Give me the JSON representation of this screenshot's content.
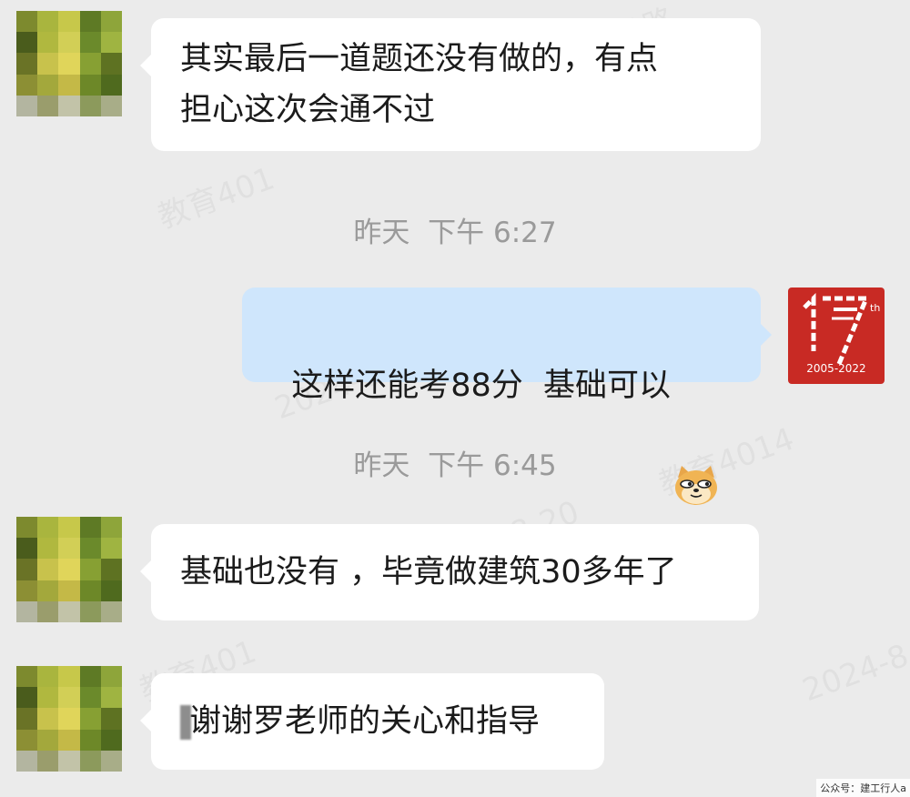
{
  "messages": [
    {
      "side": "left",
      "lines": [
        "其实最后一道题还没有做的，有点",
        "担心这次会通不过"
      ]
    },
    {
      "side": "left",
      "text": "基础也没有 ，毕竟做建筑30多年了"
    },
    {
      "side": "left",
      "text": "谢谢罗老师的关心和指导"
    }
  ],
  "reply": {
    "text": "这样还能考88分  基础可以",
    "emoji": "doge-cat-emoji"
  },
  "timestamps": [
    {
      "day": "昨天",
      "period": "下午",
      "time": "6:27"
    },
    {
      "day": "昨天",
      "period": "下午",
      "time": "6:45"
    }
  ],
  "self_avatar": {
    "big_number": "17",
    "superscript": "th",
    "years": "2005-2022",
    "color": "#c82a24"
  },
  "footer": "公众号：建工行人a",
  "colors": {
    "background": "#ebebeb",
    "incoming_bubble": "#ffffff",
    "outgoing_bubble": "#cfe6fc",
    "timestamp": "#9a9a9a"
  }
}
